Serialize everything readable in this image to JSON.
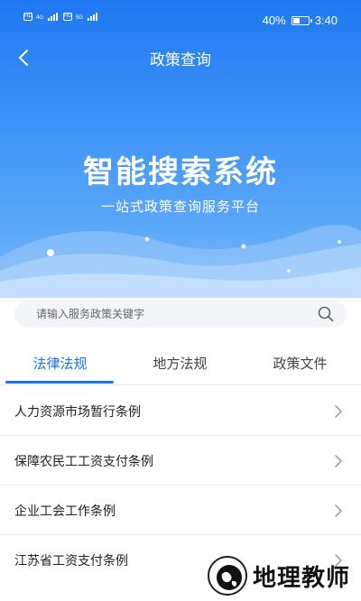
{
  "status_bar": {
    "sim1": "HD",
    "sim2": "HD",
    "net1": "4G",
    "net2": "5G",
    "battery_percent": "40%",
    "battery_level": 0.4,
    "time": "3:40"
  },
  "nav": {
    "title": "政策查询",
    "back_icon": "chevron-left-icon"
  },
  "hero": {
    "title": "智能搜索系统",
    "subtitle": "一站式政策查询服务平台"
  },
  "search": {
    "placeholder": "请输入服务政策关键字",
    "value": "",
    "icon": "search-icon"
  },
  "tabs": [
    {
      "label": "法律法规",
      "active": true
    },
    {
      "label": "地方法规",
      "active": false
    },
    {
      "label": "政策文件",
      "active": false
    }
  ],
  "list": [
    {
      "label": "人力资源市场暂行条例"
    },
    {
      "label": "保障农民工工资支付条例"
    },
    {
      "label": "企业工会工作条例"
    },
    {
      "label": "江苏省工资支付条例"
    }
  ],
  "watermark": {
    "text": "地理教师",
    "logo_ring_text": "JSNEWS"
  },
  "colors": {
    "accent": "#1a73e8",
    "hero_top": "#1f78f2",
    "hero_bottom": "#7ab9fa"
  }
}
